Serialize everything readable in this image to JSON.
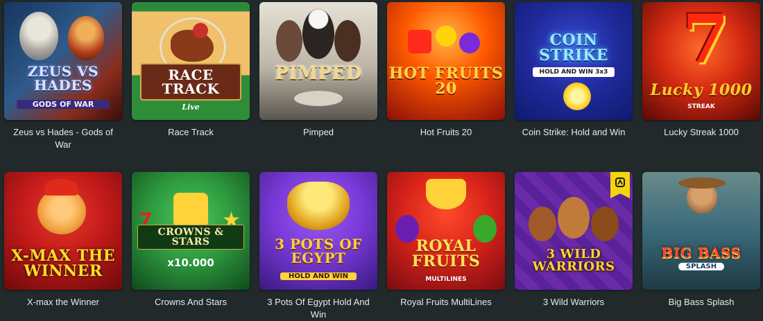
{
  "games": [
    {
      "title": "Zeus vs Hades - Gods of War",
      "logo_text": "ZEUS VS HADES",
      "logo_sub": "GODS OF WAR",
      "colors": {
        "bg1": "#1c3d6b",
        "bg2": "#8a2d1d",
        "logo": "#c9d9ff",
        "accent": "#d9412a"
      },
      "icon": "zeus-hades-art"
    },
    {
      "title": "Race Track",
      "logo_text": "RACE TRACK",
      "logo_sub": "Live",
      "colors": {
        "bg1": "#e8a64b",
        "bg2": "#2f8d3a",
        "logo": "#ffffff",
        "accent": "#7a2e1a"
      },
      "icon": "horse-racing-art"
    },
    {
      "title": "Pimped",
      "logo_text": "PIMPED",
      "logo_sub": "",
      "colors": {
        "bg1": "#d8d3c9",
        "bg2": "#5e5a52",
        "logo": "#e6c878",
        "accent": "#3b2f25"
      },
      "icon": "pimped-art"
    },
    {
      "title": "Hot Fruits 20",
      "logo_text": "HOT FRUITS 20",
      "logo_sub": "",
      "colors": {
        "bg1": "#ff6a00",
        "bg2": "#8d0e08",
        "logo": "#ffd34a",
        "accent": "#ffef9a"
      },
      "icon": "hot-fruits-art"
    },
    {
      "title": "Coin Strike: Hold and Win",
      "logo_text": "COIN STRIKE",
      "logo_sub": "HOLD AND WIN 3x3",
      "colors": {
        "bg1": "#2a3ab8",
        "bg2": "#0f1a6e",
        "logo": "#8fe0ff",
        "accent": "#ffd12a"
      },
      "icon": "coin-strike-art"
    },
    {
      "title": "Lucky Streak 1000",
      "logo_text": "Lucky 1000",
      "logo_sub": "STREAK",
      "colors": {
        "bg1": "#d42a12",
        "bg2": "#5a0904",
        "logo": "#ffcd2a",
        "accent": "#ff4a1c"
      },
      "icon": "lucky-seven-art"
    },
    {
      "title": "X-max the Winner",
      "logo_text": "X-MAX THE WINNER",
      "logo_sub": "",
      "colors": {
        "bg1": "#c21a1a",
        "bg2": "#6e0a0a",
        "logo": "#ffdd2a",
        "accent": "#f2a340"
      },
      "icon": "xmax-cat-art"
    },
    {
      "title": "Crowns And Stars",
      "logo_text": "CROWNS & STARS",
      "logo_sub": "x10.000",
      "colors": {
        "bg1": "#2f9a3f",
        "bg2": "#0f4a1c",
        "logo": "#ffe9a8",
        "accent": "#e0231b"
      },
      "icon": "crowns-stars-art"
    },
    {
      "title": "3 Pots Of Egypt Hold And Win",
      "logo_text": "3 POTS OF EGYPT",
      "logo_sub": "HOLD AND WIN",
      "colors": {
        "bg1": "#7a3ad8",
        "bg2": "#3a1980",
        "logo": "#ffcf3a",
        "accent": "#2f6fe0"
      },
      "icon": "pots-egypt-art"
    },
    {
      "title": "Royal Fruits MultiLines",
      "logo_text": "ROYAL FRUITS",
      "logo_sub": "MULTILINES",
      "colors": {
        "bg1": "#d8231a",
        "bg2": "#7a0b10",
        "logo": "#ffe25a",
        "accent": "#6a1fb0"
      },
      "icon": "royal-fruits-art"
    },
    {
      "title": "3 Wild Warriors",
      "logo_text": "3 WILD WARRIORS",
      "logo_sub": "",
      "colors": {
        "bg1": "#6b2aa8",
        "bg2": "#2f0f55",
        "logo": "#ffd23a",
        "accent": "#a05a2a"
      },
      "icon": "wild-warriors-art",
      "badge": "featured-badge-icon"
    },
    {
      "title": "Big Bass Splash",
      "logo_text": "BIG BASS",
      "logo_sub": "SPLASH",
      "colors": {
        "bg1": "#3a6a7a",
        "bg2": "#1e3a44",
        "logo": "#ff4a2a",
        "accent": "#ffd64a"
      },
      "icon": "big-bass-art"
    }
  ]
}
